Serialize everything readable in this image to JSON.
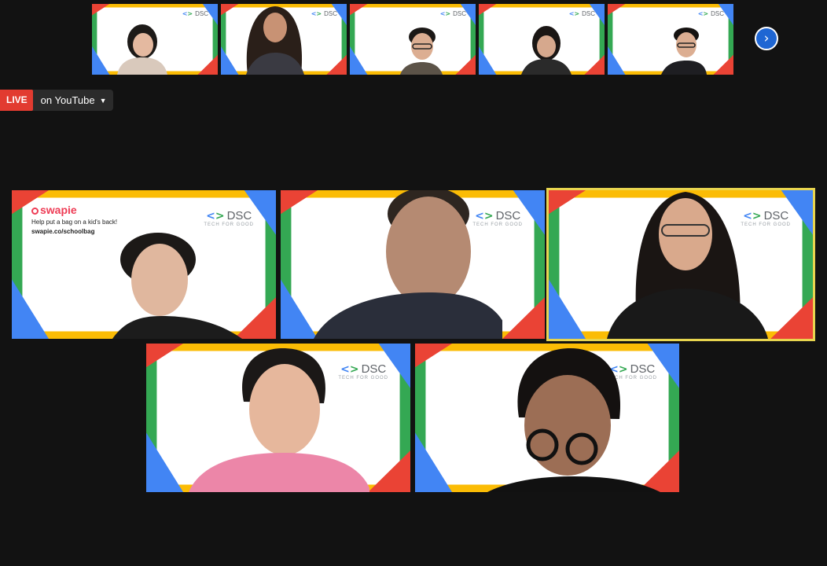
{
  "live": {
    "badge": "LIVE",
    "text": "on YouTube"
  },
  "logo": {
    "brand": "DSC",
    "tagline": "TECH FOR GOOD"
  },
  "swapie": {
    "brand": "swapie",
    "line1": "Help put a bag on a kid's back!",
    "line2": "swapie.co/schoolbag"
  },
  "colors": {
    "blue": "#4285F4",
    "red": "#EA4335",
    "yellow": "#FBBC05",
    "green": "#34A853",
    "speaker_outline": "#e8d54f",
    "live_red": "#e23b30"
  },
  "icons": {
    "next": "chevron-right-icon",
    "caret": "caret-down-icon"
  }
}
